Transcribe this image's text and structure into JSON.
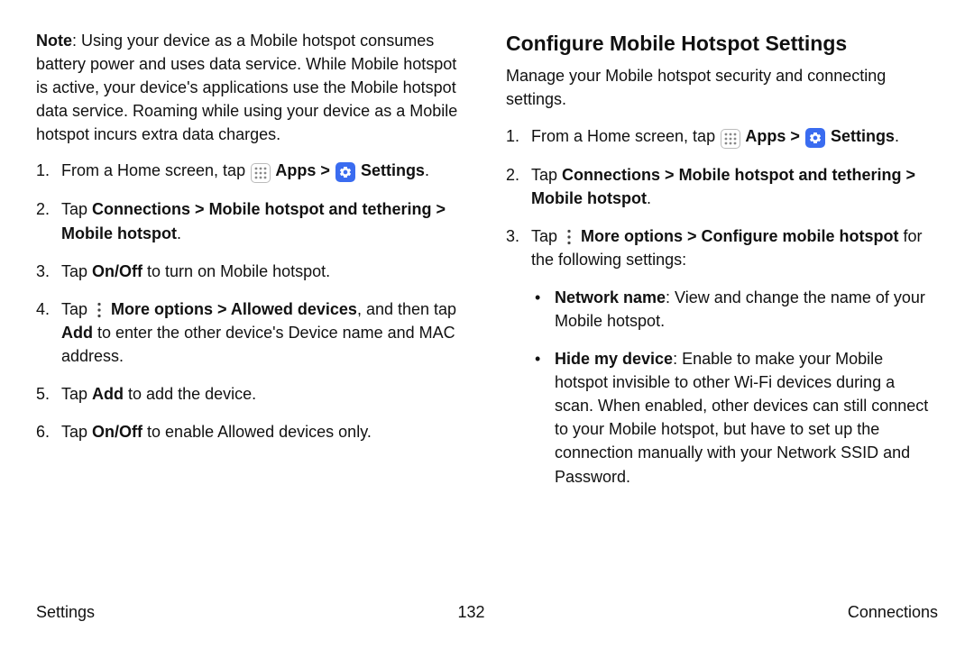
{
  "left": {
    "note_label": "Note",
    "note_body": ": Using your device as a Mobile hotspot consumes battery power and uses data service. While Mobile hotspot is active, your device's applications use the Mobile hotspot data service. Roaming while using your device as a Mobile hotspot incurs extra data charges.",
    "step1_pre": "From a Home screen, tap ",
    "step1_apps": " Apps",
    "step1_settings": " Settings",
    "step1_post": ".",
    "step2_a": "Tap ",
    "step2_b": "Connections",
    "step2_c": "Mobile hotspot and tethering",
    "step2_d": "Mobile hotspot",
    "step2_e": ".",
    "step3_a": "Tap ",
    "step3_b": "On/Off",
    "step3_c": " to turn on Mobile hotspot.",
    "step4_a": "Tap ",
    "step4_b": " More options",
    "step4_c": "Allowed devices",
    "step4_d": ", and then tap ",
    "step4_e": "Add",
    "step4_f": " to enter the other device's Device name and MAC address.",
    "step5_a": "Tap ",
    "step5_b": "Add",
    "step5_c": " to add the device.",
    "step6_a": "Tap ",
    "step6_b": "On/Off",
    "step6_c": " to enable Allowed devices only."
  },
  "right": {
    "heading": "Configure Mobile Hotspot Settings",
    "intro": "Manage your Mobile hotspot security and connecting settings.",
    "step1_pre": "From a Home screen, tap ",
    "step1_apps": " Apps",
    "step1_settings": " Settings",
    "step1_post": ".",
    "step2_a": "Tap ",
    "step2_b": "Connections",
    "step2_c": "Mobile hotspot and tethering",
    "step2_d": "Mobile hotspot",
    "step2_e": ".",
    "step3_a": "Tap ",
    "step3_b": " More options",
    "step3_c": "Configure mobile hotspot",
    "step3_d": " for the following settings:",
    "b1_a": "Network name",
    "b1_b": ": View and change the name of your Mobile hotspot.",
    "b2_a": "Hide my device",
    "b2_b": ": Enable to make your Mobile hotspot invisible to other Wi-Fi devices during a scan. When enabled, other devices can still connect to your Mobile hotspot, but have to set up the connection manually with your Network SSID and Password."
  },
  "footer": {
    "left": "Settings",
    "center": "132",
    "right": "Connections"
  },
  "chev": " > "
}
